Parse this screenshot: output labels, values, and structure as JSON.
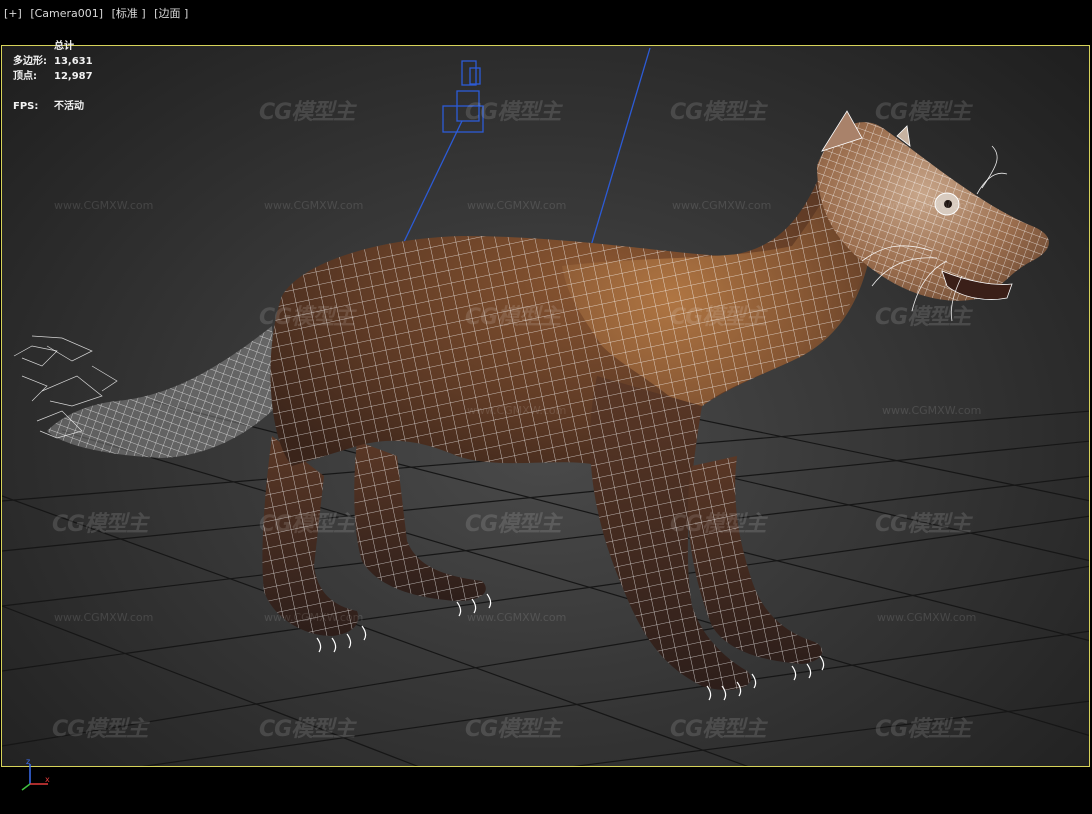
{
  "viewport_label": {
    "plus": "[+]",
    "camera": "[Camera001]",
    "shading": "[标准 ]",
    "edges": "[边面 ]"
  },
  "stats": {
    "title": "总计",
    "polygons_label": "多边形:",
    "polygons_value": "13,631",
    "vertices_label": "顶点:",
    "vertices_value": "12,987",
    "fps_label": "FPS:",
    "fps_value": "不活动"
  },
  "watermark": {
    "logo": "CG模型主",
    "url": "www.CGMXW.com"
  },
  "axis_gizmo": {
    "z": "z",
    "x": "x"
  },
  "colors": {
    "viewport_border": "#d7d35a",
    "camera_wire": "#2c5bd6",
    "mesh_wire": "#ffffff",
    "fur": "#7a4a2c"
  }
}
